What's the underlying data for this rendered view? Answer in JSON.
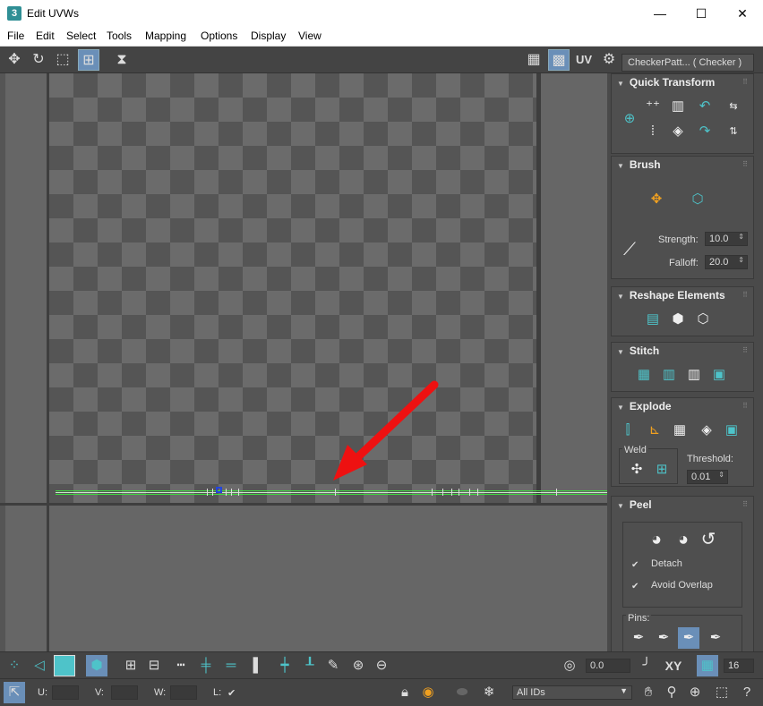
{
  "window": {
    "app_icon": "3",
    "title": "Edit UVWs",
    "minimize": "—",
    "maximize": "☐",
    "close": "✕"
  },
  "menu": [
    "File",
    "Edit",
    "Select",
    "Tools",
    "Mapping",
    "Options",
    "Display",
    "View"
  ],
  "toolbar": {
    "uv_label": "UV",
    "map_select": "CheckerPatt... ( Checker )"
  },
  "rollouts": {
    "quick_transform": {
      "title": "Quick Transform"
    },
    "brush": {
      "title": "Brush",
      "strength_label": "Strength:",
      "strength_value": "10.0",
      "falloff_label": "Falloff:",
      "falloff_value": "20.0"
    },
    "reshape": {
      "title": "Reshape Elements"
    },
    "stitch": {
      "title": "Stitch"
    },
    "explode": {
      "title": "Explode",
      "weld_label": "Weld",
      "threshold_label": "Threshold:",
      "threshold_value": "0.01"
    },
    "peel": {
      "title": "Peel",
      "detach_label": "Detach",
      "detach_checked": true,
      "avoid_overlap_label": "Avoid Overlap",
      "avoid_overlap_checked": true,
      "pins_label": "Pins:"
    }
  },
  "bottom": {
    "angle_value": "0.0",
    "xy_label": "XY",
    "grid_value": "16",
    "u_label": "U:",
    "v_label": "V:",
    "w_label": "W:",
    "l_label": "L:",
    "ids_select": "All IDs"
  },
  "colors": {
    "accent": "#4ec3c9",
    "uv_edge": "#3fd83f",
    "arrow": "#ee1111",
    "active_button": "#6a8fb8"
  }
}
